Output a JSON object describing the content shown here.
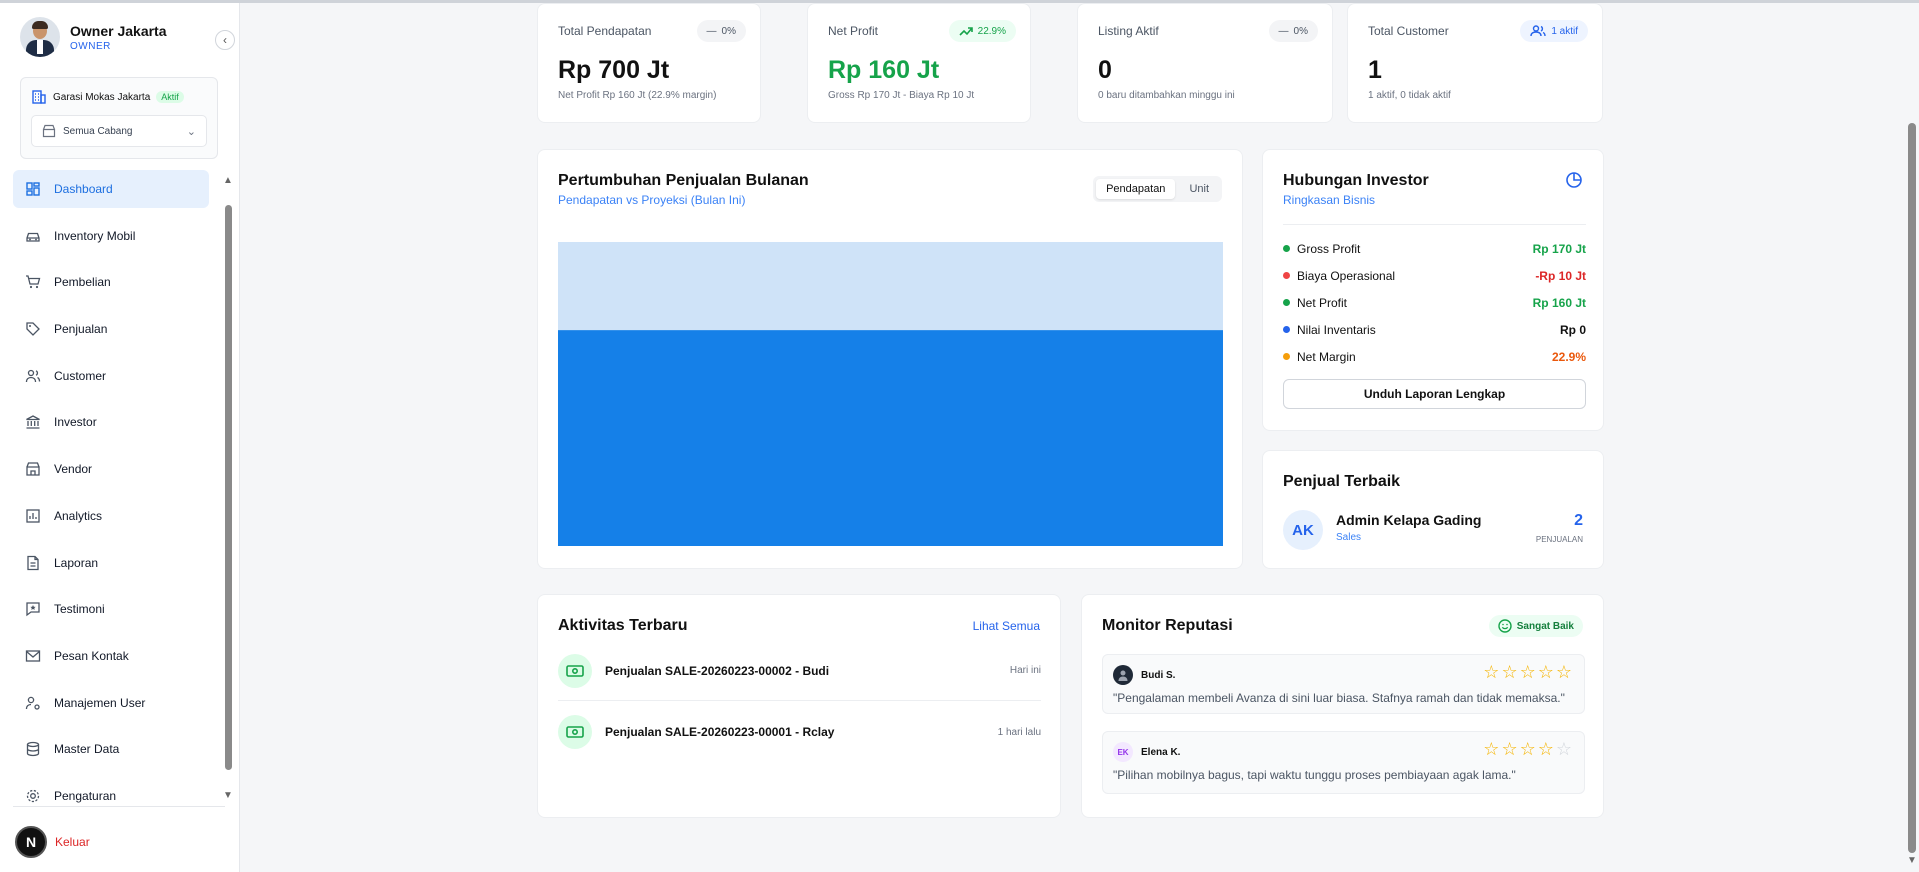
{
  "user": {
    "name": "Owner Jakarta",
    "role": "OWNER"
  },
  "branch": {
    "name": "Garasi Mokas Jakarta",
    "status": "Aktif",
    "selector": "Semua Cabang"
  },
  "nav": {
    "items": [
      {
        "label": "Dashboard",
        "icon": "dashboard-icon"
      },
      {
        "label": "Inventory Mobil",
        "icon": "car-icon"
      },
      {
        "label": "Pembelian",
        "icon": "cart-icon"
      },
      {
        "label": "Penjualan",
        "icon": "tag-icon"
      },
      {
        "label": "Customer",
        "icon": "users-icon"
      },
      {
        "label": "Investor",
        "icon": "bank-icon"
      },
      {
        "label": "Vendor",
        "icon": "store-icon"
      },
      {
        "label": "Analytics",
        "icon": "analytics-icon"
      },
      {
        "label": "Laporan",
        "icon": "report-icon"
      },
      {
        "label": "Testimoni",
        "icon": "star-message-icon"
      },
      {
        "label": "Pesan Kontak",
        "icon": "mail-icon"
      },
      {
        "label": "Manajemen User",
        "icon": "user-settings-icon"
      },
      {
        "label": "Master Data",
        "icon": "database-icon"
      },
      {
        "label": "Pengaturan",
        "icon": "gear-icon"
      }
    ],
    "logout": "Keluar",
    "logo_letter": "N"
  },
  "stats": [
    {
      "title": "Total Pendapatan",
      "badge": "0%",
      "value": "Rp 700 Jt",
      "sub": "Net Profit Rp 160 Jt (22.9% margin)"
    },
    {
      "title": "Net Profit",
      "badge": "22.9%",
      "value": "Rp 160 Jt",
      "sub": "Gross Rp 170 Jt - Biaya Rp 10 Jt"
    },
    {
      "title": "Listing Aktif",
      "badge": "0%",
      "value": "0",
      "sub": "0 baru ditambahkan minggu ini"
    },
    {
      "title": "Total Customer",
      "badge": "1 aktif",
      "value": "1",
      "sub": "1 aktif, 0 tidak aktif"
    }
  ],
  "sales_chart": {
    "title": "Pertumbuhan Penjualan Bulanan",
    "subtitle": "Pendapatan vs Proyeksi (Bulan Ini)",
    "toggle": [
      "Pendapatan",
      "Unit"
    ],
    "active_toggle": "Pendapatan"
  },
  "chart_data": {
    "type": "area",
    "series": [
      {
        "values": [
          1.0
        ],
        "color": "#cfe3f8"
      },
      {
        "values": [
          0.71
        ],
        "color": "#1580e8"
      }
    ],
    "ylim": [
      0,
      1
    ],
    "grid": false
  },
  "investor": {
    "title": "Hubungan Investor",
    "subtitle": "Ringkasan Bisnis",
    "rows": [
      {
        "label": "Gross Profit",
        "value": "Rp 170 Jt",
        "dot": "#16a34a",
        "color": "#16a34a"
      },
      {
        "label": "Biaya Operasional",
        "value": "-Rp 10 Jt",
        "dot": "#ef4444",
        "color": "#dc2626"
      },
      {
        "label": "Net Profit",
        "value": "Rp 160 Jt",
        "dot": "#16a34a",
        "color": "#16a34a"
      },
      {
        "label": "Nilai Inventaris",
        "value": "Rp 0",
        "dot": "#2563eb",
        "color": "#111111"
      },
      {
        "label": "Net Margin",
        "value": "22.9%",
        "dot": "#f59e0b",
        "color": "#ea580c"
      }
    ],
    "button": "Unduh Laporan Lengkap"
  },
  "top_seller": {
    "title": "Penjual Terbaik",
    "initials": "AK",
    "name": "Admin Kelapa Gading",
    "role": "Sales",
    "count": "2",
    "count_label": "PENJUALAN"
  },
  "activity": {
    "title": "Aktivitas Terbaru",
    "link": "Lihat Semua",
    "items": [
      {
        "text": "Penjualan SALE-20260223-00002 - Budi",
        "time": "Hari ini"
      },
      {
        "text": "Penjualan SALE-20260223-00001 - Rclay",
        "time": "1 hari lalu"
      }
    ]
  },
  "reputation": {
    "title": "Monitor Reputasi",
    "badge": "Sangat Baik",
    "reviews": [
      {
        "name": "Budi S.",
        "initials": "",
        "rating": 5,
        "text": "\"Pengalaman membeli Avanza di sini luar biasa. Stafnya ramah dan tidak memaksa.\""
      },
      {
        "name": "Elena K.",
        "initials": "EK",
        "rating": 4,
        "text": "\"Pilihan mobilnya bagus, tapi waktu tunggu proses pembiayaan agak lama.\""
      }
    ]
  }
}
